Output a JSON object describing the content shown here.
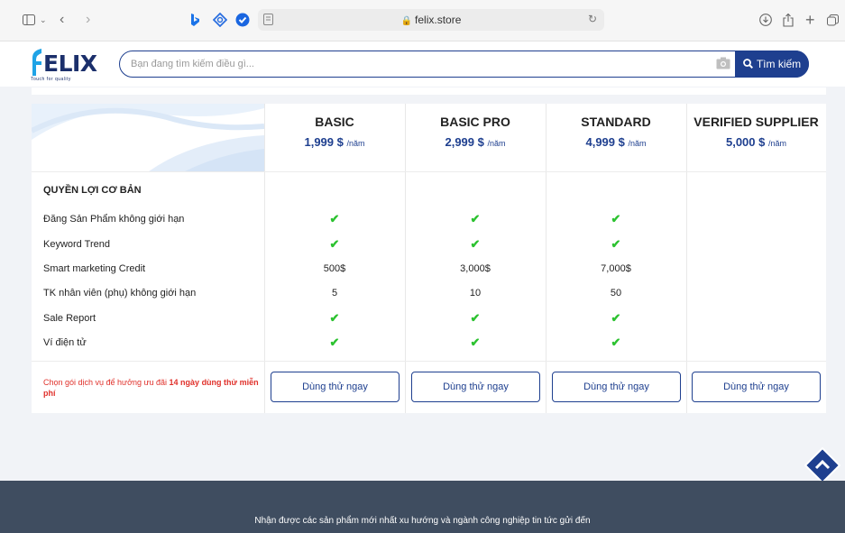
{
  "browser": {
    "url": "felix.store",
    "icons": [
      "sidebar-icon",
      "chevron-down-icon",
      "back-icon",
      "forward-icon",
      "bing-icon",
      "extension-icon",
      "check-badge-icon",
      "reader-icon",
      "lock-icon",
      "reload-icon",
      "download-icon",
      "share-icon",
      "new-tab-icon",
      "tabs-icon"
    ]
  },
  "header": {
    "logo_text": "ELIX",
    "logo_tagline": "Touch for quality",
    "search_placeholder": "Bạn đang tìm kiếm điều gì...",
    "search_button": "Tìm kiếm",
    "brand_color": "#1e3f8f"
  },
  "pricing": {
    "plans": [
      {
        "name": "BASIC",
        "price": "1,999 $",
        "period": "/năm"
      },
      {
        "name": "BASIC PRO",
        "price": "2,999 $",
        "period": "/năm"
      },
      {
        "name": "STANDARD",
        "price": "4,999 $",
        "period": "/năm"
      },
      {
        "name": "VERIFIED SUPPLIER",
        "price": "5,000 $",
        "period": "/năm"
      }
    ],
    "section_title": "QUYỀN LỢI CƠ BẢN",
    "features": [
      {
        "label": "Đăng Sản Phẩm không giới hạn",
        "values": [
          "check",
          "check",
          "check",
          ""
        ]
      },
      {
        "label": "Keyword Trend",
        "values": [
          "check",
          "check",
          "check",
          ""
        ]
      },
      {
        "label": "Smart marketing Credit",
        "values": [
          "500$",
          "3,000$",
          "7,000$",
          ""
        ]
      },
      {
        "label": "TK nhân viên (phụ) không giới hạn",
        "values": [
          "5",
          "10",
          "50",
          ""
        ]
      },
      {
        "label": "Sale Report",
        "values": [
          "check",
          "check",
          "check",
          ""
        ]
      },
      {
        "label": "Ví điện tử",
        "values": [
          "check",
          "check",
          "check",
          ""
        ]
      }
    ],
    "check_color": "#2cc230",
    "note_prefix": "Chọn gói dịch vụ để hưởng ưu đãi ",
    "note_bold": "14 ngày dùng thử miễn phí",
    "try_button": "Dùng thử ngay"
  },
  "footer": {
    "text": "Nhận được các sản phẩm mới nhất xu hướng và ngành công nghiệp tin tức gửi đến"
  }
}
